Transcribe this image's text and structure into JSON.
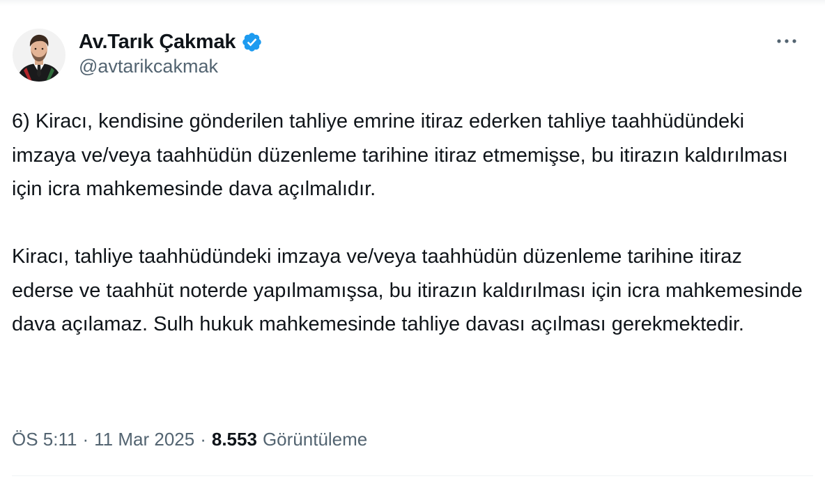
{
  "author": {
    "display_name": "Av.Tarık Çakmak",
    "handle": "@avtarikcakmak",
    "verified": true,
    "verified_color": "#1d9bf0"
  },
  "tweet": {
    "paragraphs": [
      "6) Kiracı, kendisine gönderilen tahliye emrine itiraz ederken tahliye taahhüdündeki imzaya ve/veya taahhüdün düzenleme tarihine itiraz etmemişse, bu itirazın kaldırılması için icra mahkemesinde dava açılmalıdır.",
      "Kiracı, tahliye taahhüdündeki imzaya ve/veya taahhüdün düzenleme tarihine itiraz ederse ve taahhüt noterde yapılmamışsa, bu itirazın kaldırılması için icra mahkemesinde dava açılamaz. Sulh hukuk mahkemesinde tahliye davası açılması gerekmektedir."
    ]
  },
  "meta": {
    "time": "ÖS 5:11",
    "separator": "·",
    "date": "11 Mar 2025",
    "views_count": "8.553",
    "views_label": "Görüntüleme"
  },
  "icons": {
    "more": "more-horizontal-icon",
    "verified": "verified-badge-icon",
    "avatar": "profile-photo"
  },
  "colors": {
    "text_primary": "#0f1419",
    "text_secondary": "#536471",
    "divider": "#eff3f4"
  }
}
